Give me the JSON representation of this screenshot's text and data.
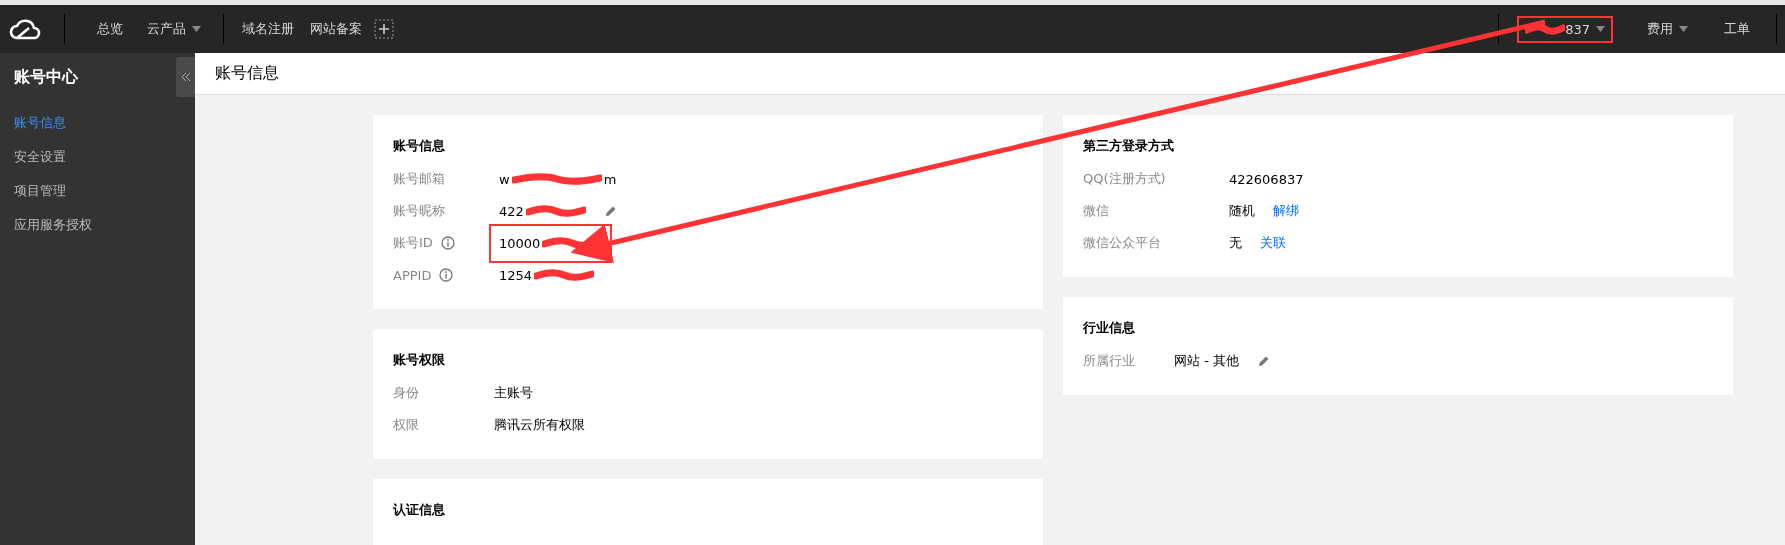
{
  "top_bar": {
    "nav": [
      {
        "label": "总览"
      },
      {
        "label": "云产品",
        "dropdown": true
      }
    ],
    "links": [
      {
        "label": "域名注册"
      },
      {
        "label": "网站备案"
      }
    ],
    "account": {
      "value_end": "837",
      "redacted": true,
      "highlighted": true,
      "dropdown": true
    },
    "right": [
      {
        "label": "费用",
        "dropdown": true
      },
      {
        "label": "工单"
      }
    ]
  },
  "sidebar": {
    "title": "账号中心",
    "items": [
      {
        "label": "账号信息",
        "selected": true
      },
      {
        "label": "安全设置",
        "selected": false
      },
      {
        "label": "项目管理",
        "selected": false
      },
      {
        "label": "应用服务授权",
        "selected": false
      }
    ]
  },
  "page_title": "账号信息",
  "left_cards": [
    {
      "title": "账号信息",
      "rows": [
        {
          "label": "账号邮箱",
          "redacted": true,
          "value_start": "w",
          "value_end": "m"
        },
        {
          "label": "账号昵称",
          "editable": true,
          "redacted": true,
          "value_start": "422"
        },
        {
          "label": "账号ID",
          "info": true,
          "redacted": true,
          "value_start": "10000",
          "highlighted": true
        },
        {
          "label": "APPID",
          "info": true,
          "redacted": true,
          "value_start": "1254"
        }
      ]
    },
    {
      "title": "账号权限",
      "rows": [
        {
          "label": "身份",
          "value_start": "主账号"
        },
        {
          "label": "权限",
          "value_start": "腾讯云所有权限"
        }
      ]
    },
    {
      "title": "认证信息"
    }
  ],
  "right_cards": [
    {
      "title": "第三方登录方式",
      "rows": [
        {
          "label": "QQ(注册方式)",
          "value_start": "422606837"
        },
        {
          "label": "微信",
          "value_start": "随机",
          "link": "解绑"
        },
        {
          "label": "微信公众平台",
          "value_start": "无",
          "link": "关联"
        }
      ]
    },
    {
      "title": "行业信息",
      "rows": [
        {
          "label": "所属行业",
          "editable": true,
          "value_start": "网站 - 其他"
        }
      ]
    }
  ]
}
